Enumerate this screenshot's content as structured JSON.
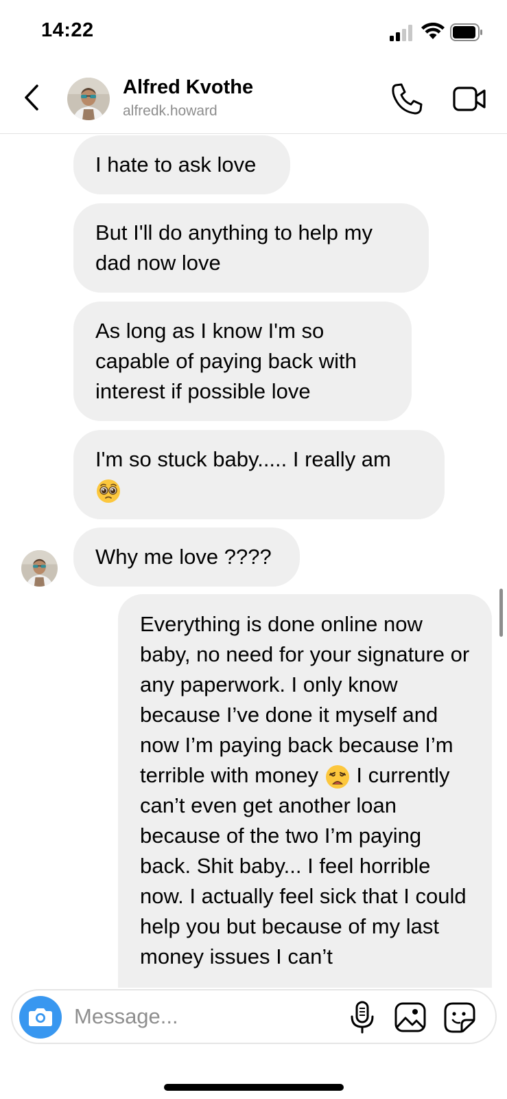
{
  "status_bar": {
    "time": "14:22"
  },
  "header": {
    "name": "Alfred Kvothe",
    "username": "alfredk.howard"
  },
  "messages": [
    {
      "side": "left",
      "text": "I hate to ask love"
    },
    {
      "side": "left",
      "text": "But I'll do anything to help my dad now love"
    },
    {
      "side": "left",
      "text": "As long as I know I'm so capable of paying back with interest if possible love"
    },
    {
      "side": "left",
      "text": "I'm so stuck baby..... I really am",
      "emoji": "pleading-face"
    },
    {
      "side": "left",
      "text": "Why me love ????"
    },
    {
      "side": "right",
      "text_before_emoji": "Everything is done online now baby, no need for your signature or any paperwork. I only know because I’ve done it myself and now I’m paying back because I’m terrible with money",
      "emoji": "weary-face",
      "text_after_emoji": "I currently can’t even get another loan because of the two I’m paying back. Shit baby... I feel horrible now. I actually feel sick that I could help you but because of my last money issues I can’t"
    }
  ],
  "composer": {
    "placeholder": "Message..."
  },
  "icons": {
    "back": "chevron-left-icon",
    "call": "phone-icon",
    "video": "video-camera-icon",
    "camera": "camera-icon",
    "mic": "microphone-icon",
    "gallery": "image-icon",
    "sticker": "sticker-icon"
  },
  "colors": {
    "accent": "#3897f0",
    "bubble": "#efefef",
    "secondary_text": "#8e8e8e"
  }
}
